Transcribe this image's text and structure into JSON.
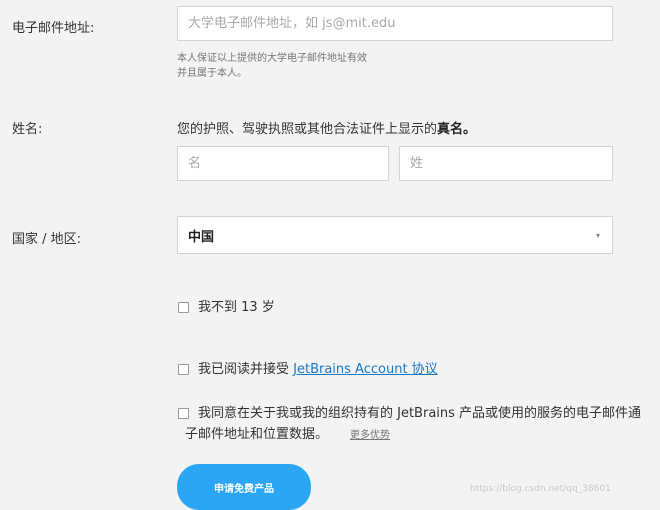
{
  "form": {
    "email": {
      "label": "电子邮件地址:",
      "placeholder": "大学电子邮件地址，如 js@mit.edu",
      "hint_line1": "本人保证以上提供的大学电子邮件地址有效",
      "hint_line2": "并且属于本人。"
    },
    "name": {
      "label": "姓名:",
      "desc_prefix": "您的护照、驾驶执照或其他合法证件上显示的",
      "desc_bold": "真名。",
      "first_placeholder": "名",
      "last_placeholder": "姓"
    },
    "country": {
      "label": "国家 / 地区:",
      "value": "中国",
      "caret_icon": "▾"
    },
    "checkboxes": {
      "under13": {
        "text": "我不到 13 岁"
      },
      "agree": {
        "prefix": "我已阅读并接受 ",
        "link": "JetBrains Account 协议"
      },
      "marketing": {
        "line1": "我同意在关于我或我的组织持有的 JetBrains 产品或使用的服务的电子邮件通",
        "line2": "子邮件地址和位置数据。",
        "more": "更多优势"
      }
    },
    "submit_label": "申请免费产品"
  },
  "watermark": "https://blog.csdn.net/qq_38601"
}
